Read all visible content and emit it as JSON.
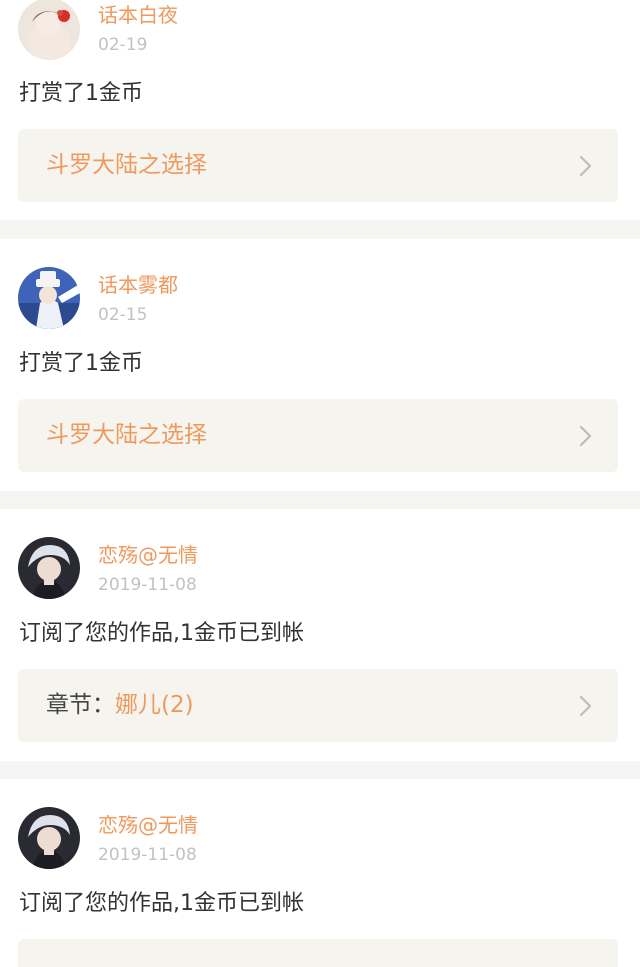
{
  "notifications": [
    {
      "username": "话本白夜",
      "date": "02-19",
      "action": "打赏了1金币",
      "link_label": "",
      "link_value": "斗罗大陆之选择"
    },
    {
      "username": "话本雾都",
      "date": "02-15",
      "action": "打赏了1金币",
      "link_label": "",
      "link_value": "斗罗大陆之选择"
    },
    {
      "username": "恋殇@无情",
      "date": "2019-11-08",
      "action": "订阅了您的作品,1金币已到帐",
      "link_label": "章节：",
      "link_value": "娜儿(2)"
    },
    {
      "username": "恋殇@无情",
      "date": "2019-11-08",
      "action": "订阅了您的作品,1金币已到帐",
      "link_label": "",
      "link_value": ""
    }
  ],
  "icons": {
    "chevron": "chevron-right-icon",
    "avatar": "user-avatar"
  },
  "colors": {
    "accent": "#ef9a5c",
    "card_bg": "#ffffff",
    "page_bg": "#f5f5f4",
    "link_box_bg": "#f5f4ef",
    "muted": "#c2c2c2"
  }
}
